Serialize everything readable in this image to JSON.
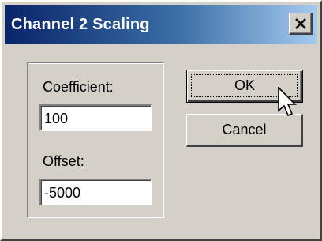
{
  "dialog": {
    "title": "Channel 2 Scaling",
    "close_icon": "close-icon"
  },
  "fields": {
    "coefficient_label": "Coefficient:",
    "coefficient_value": "100",
    "offset_label": "Offset:",
    "offset_value": "-5000"
  },
  "buttons": {
    "ok_label": "OK",
    "cancel_label": "Cancel"
  },
  "cursor": {
    "icon": "mouse-pointer-icon"
  },
  "colors": {
    "title_gradient_start": "#0a246a",
    "title_gradient_end": "#a6caf0",
    "face": "#d4d0c8"
  }
}
